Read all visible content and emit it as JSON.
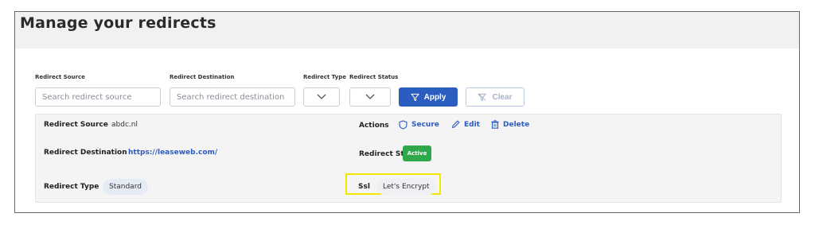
{
  "page": {
    "title": "Manage your redirects"
  },
  "filters": {
    "source_label": "Redirect Source",
    "source_placeholder": "Search redirect source",
    "destination_label": "Redirect Destination",
    "destination_placeholder": "Search redirect destination",
    "type_label": "Redirect Type",
    "status_label": "Redirect Status",
    "apply_label": "Apply",
    "clear_label": "Clear"
  },
  "record": {
    "source_label": "Redirect Source",
    "source_value": "abdc.nl",
    "destination_label": "Redirect Destination",
    "destination_value": "https://leaseweb.com/",
    "type_label": "Redirect Type",
    "type_value": "Standard",
    "actions_label": "Actions",
    "secure_label": "Secure",
    "edit_label": "Edit",
    "delete_label": "Delete",
    "status_label": "Redirect Status",
    "status_value": "Active",
    "ssl_label": "Ssl",
    "ssl_value": "Let's Encrypt"
  },
  "colors": {
    "accent": "#2b5cc0",
    "status_active": "#2ea84a",
    "highlight": "#f5e600"
  },
  "icons": [
    "filter-icon",
    "filter-clear-icon",
    "chevron-down-icon",
    "shield-icon",
    "pencil-icon",
    "trash-icon"
  ]
}
